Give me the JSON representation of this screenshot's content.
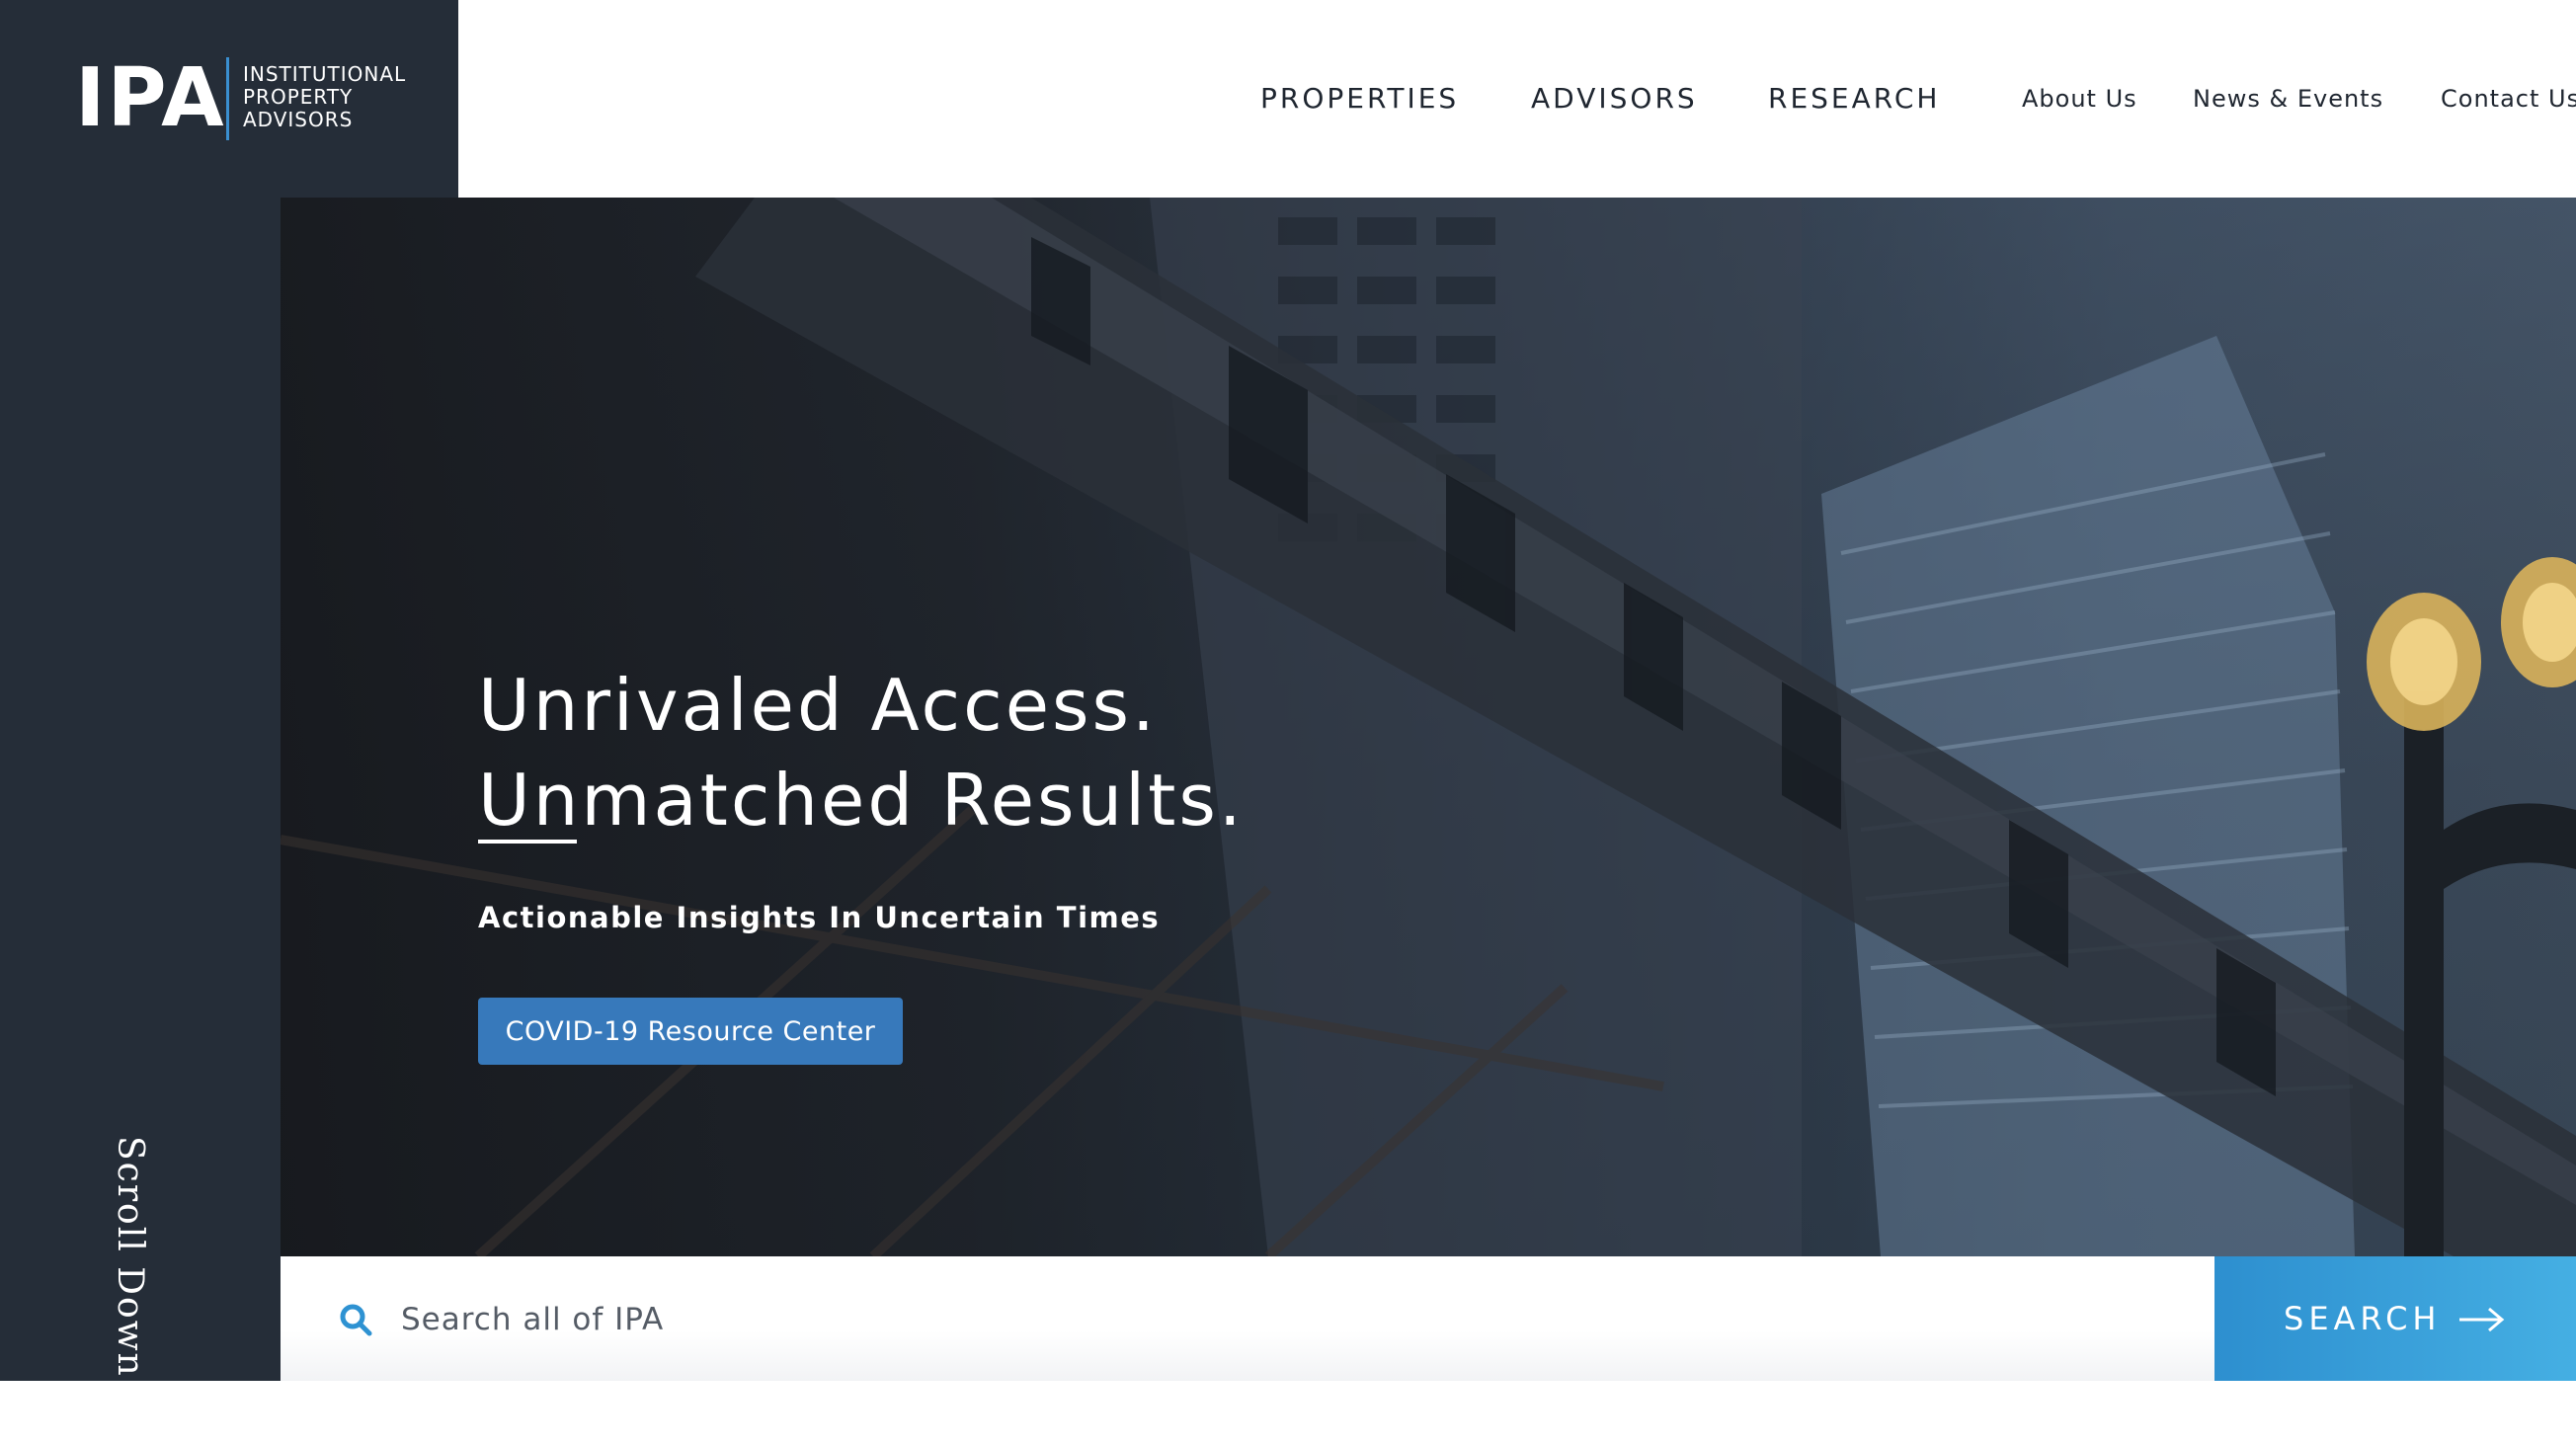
{
  "brand": {
    "logo_text": "IPA",
    "logo_sub_lines": [
      "INSTITUTIONAL",
      "PROPERTY",
      "ADVISORS"
    ]
  },
  "nav": {
    "primary": [
      {
        "label": "PROPERTIES"
      },
      {
        "label": "ADVISORS"
      },
      {
        "label": "RESEARCH"
      }
    ],
    "secondary": [
      {
        "label": "About Us"
      },
      {
        "label": "News & Events"
      },
      {
        "label": "Contact Us"
      }
    ]
  },
  "sidebar": {
    "scroll_label": "Scroll Down",
    "scroll_icon": "arrow-down-icon"
  },
  "hero": {
    "title_line1": "Unrivaled Access.",
    "title_line2": "Unmatched Results.",
    "subtitle": "Actionable Insights In Uncertain Times",
    "cta_label": "COVID-19 Resource Center"
  },
  "search": {
    "placeholder": "Search all of IPA",
    "value": "",
    "button_label": "SEARCH",
    "icon": "search-icon",
    "button_icon": "arrow-right-icon"
  },
  "colors": {
    "sidebar_bg": "#252d38",
    "accent_blue": "#3779bb",
    "search_button": "#3ea3dc",
    "logo_divider": "#3a8fd0"
  }
}
